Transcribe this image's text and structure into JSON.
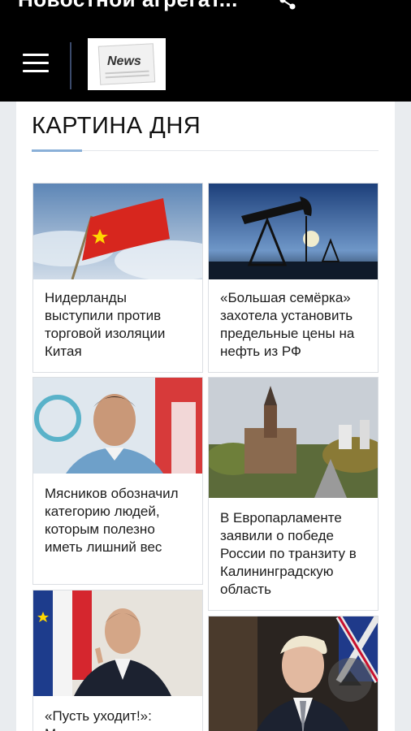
{
  "app": {
    "title": "Новостной агрегат...",
    "logo_text": "News"
  },
  "section": {
    "title": "КАРТИНА ДНЯ"
  },
  "articles": [
    {
      "headline": "Нидерланды выступили против торговой изоляции Китая"
    },
    {
      "headline": "«Большая семёрка» захотела установить предельные цены на нефть из РФ"
    },
    {
      "headline": "Мясников обозначил категорию людей, которым полезно иметь лишний вес"
    },
    {
      "headline": "В Европарламенте заявили о победе России по транзиту в Калининградскую область"
    },
    {
      "headline": "«Пусть уходит!»: Макрон заявил за..."
    },
    {
      "headline": ""
    }
  ],
  "icons": {
    "menu": "hamburger-icon",
    "share": "share-icon",
    "view": "grid-icon",
    "more": "more-vert-icon",
    "scroll_top": "arrow-up-icon"
  },
  "colors": {
    "topbar": "#000000",
    "accent": "#8ab0d8",
    "background": "#e9ecef"
  }
}
